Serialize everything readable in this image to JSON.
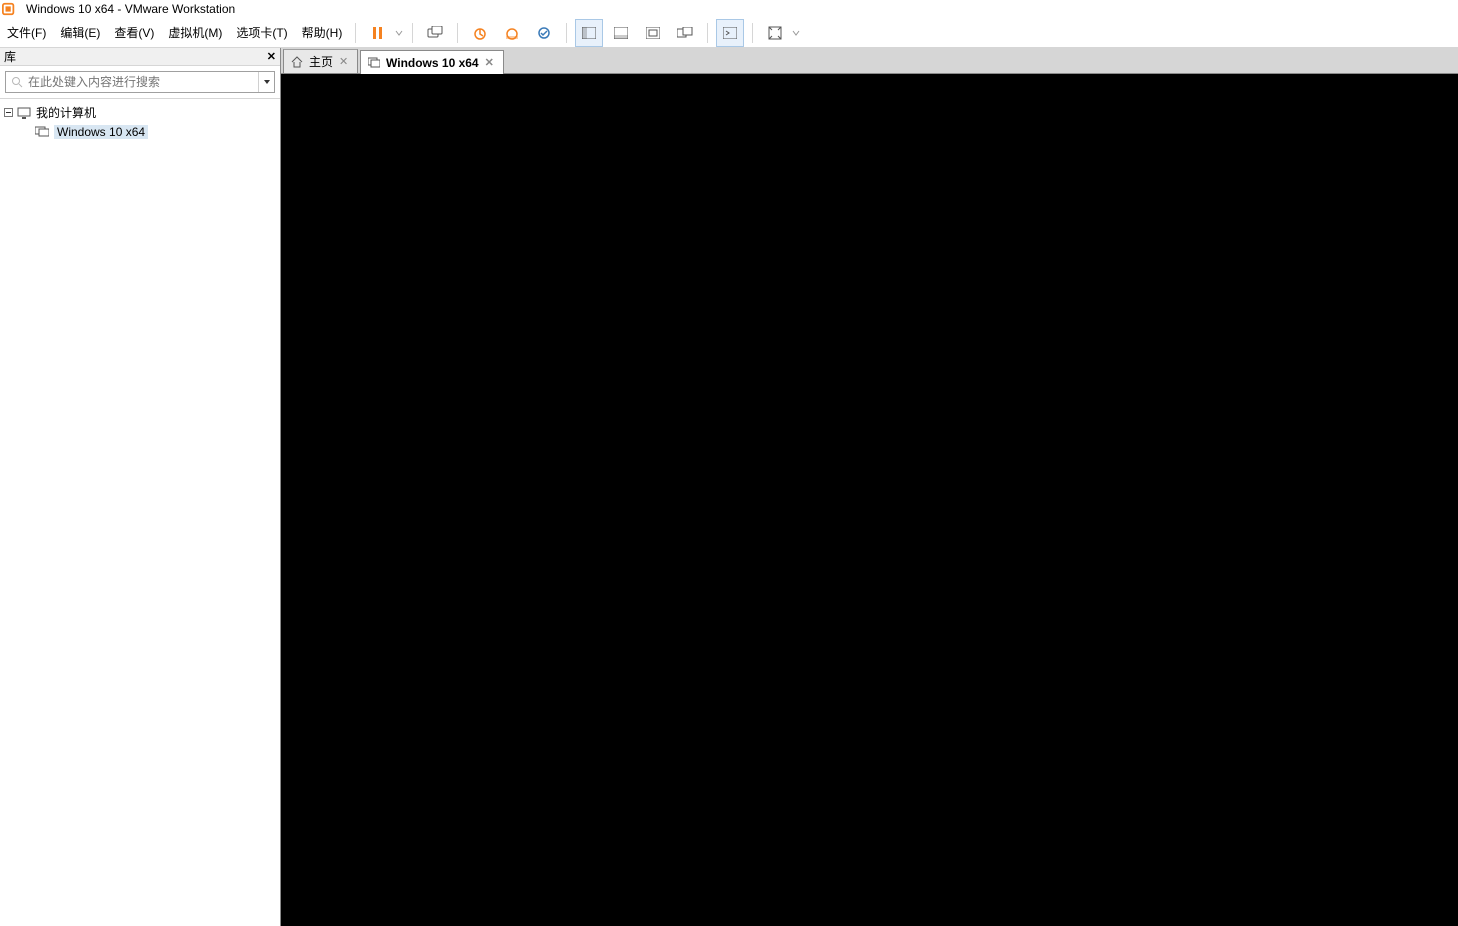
{
  "titlebar": {
    "text": "Windows 10 x64 - VMware Workstation"
  },
  "menu": {
    "file": "文件(F)",
    "edit": "编辑(E)",
    "view": "查看(V)",
    "vm": "虚拟机(M)",
    "tabs": "选项卡(T)",
    "help": "帮助(H)"
  },
  "colors": {
    "accent": "#f58220"
  },
  "library": {
    "header": "库",
    "search_placeholder": "在此处键入内容进行搜索",
    "root": "我的计算机",
    "items": [
      {
        "label": "Windows 10 x64",
        "selected": true
      }
    ]
  },
  "tabs": [
    {
      "label": "主页",
      "icon": "home-icon",
      "active": false,
      "closable": true
    },
    {
      "label": "Windows 10 x64",
      "icon": "monitor-icon",
      "active": true,
      "closable": true
    }
  ]
}
